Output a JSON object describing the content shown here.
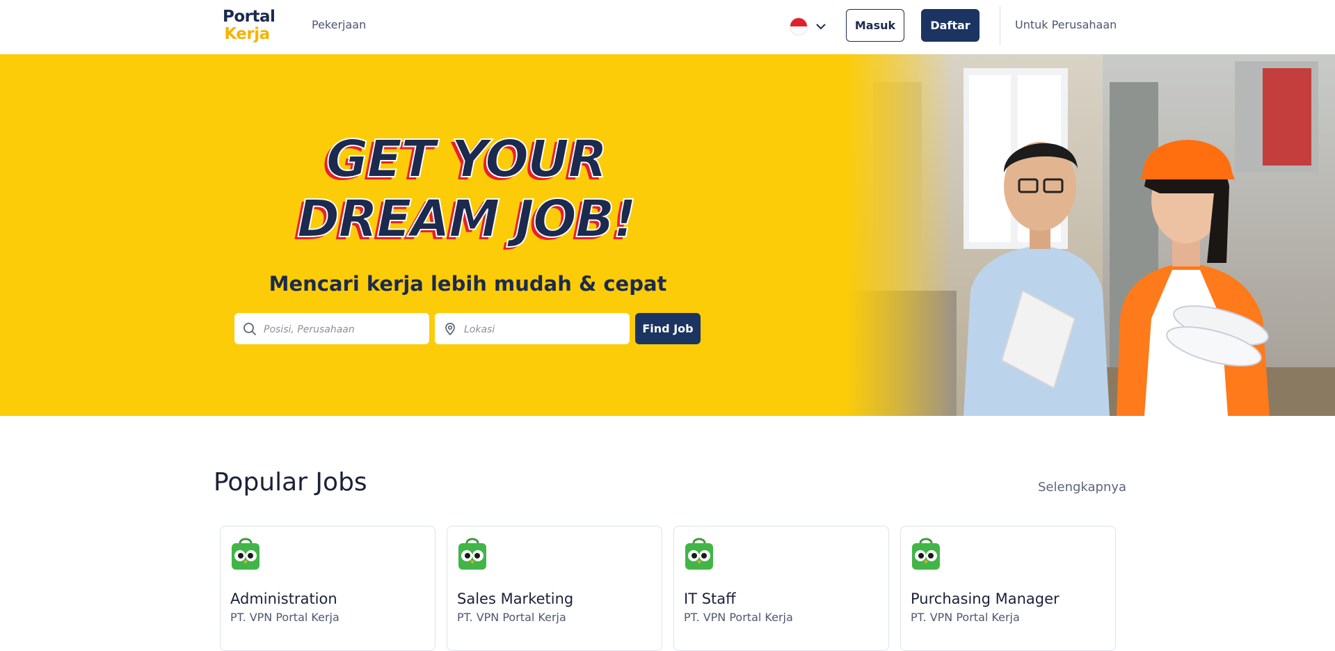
{
  "header": {
    "logo_line1": "Portal",
    "logo_line2": "Kerja",
    "nav_jobs": "Pekerjaan",
    "login_label": "Masuk",
    "register_label": "Daftar",
    "company_link": "Untuk Perusahaan"
  },
  "hero": {
    "title_line1": "GET YOUR",
    "title_line2": "DREAM JOB!",
    "subtitle": "Mencari kerja lebih mudah & cepat",
    "search_placeholder": "Posisi, Perusahaan",
    "location_placeholder": "Lokasi",
    "find_button": "Find Job"
  },
  "popular": {
    "title": "Popular Jobs",
    "more_label": "Selengkapnya",
    "jobs": [
      {
        "title": "Administration",
        "company": "PT. VPN Portal Kerja"
      },
      {
        "title": "Sales Marketing",
        "company": "PT. VPN Portal Kerja"
      },
      {
        "title": "IT Staff",
        "company": "PT. VPN Portal Kerja"
      },
      {
        "title": "Purchasing Manager",
        "company": "PT. VPN Portal Kerja"
      }
    ]
  },
  "icons": [
    "flag-indonesia-icon",
    "chevron-down-icon",
    "search-icon",
    "location-pin-icon",
    "company-logo-owl-icon"
  ],
  "colors": {
    "brand_navy": "#1b3461",
    "brand_yellow": "#fccc08",
    "accent_red": "#e8202a",
    "logo_yellow": "#f5b400"
  }
}
